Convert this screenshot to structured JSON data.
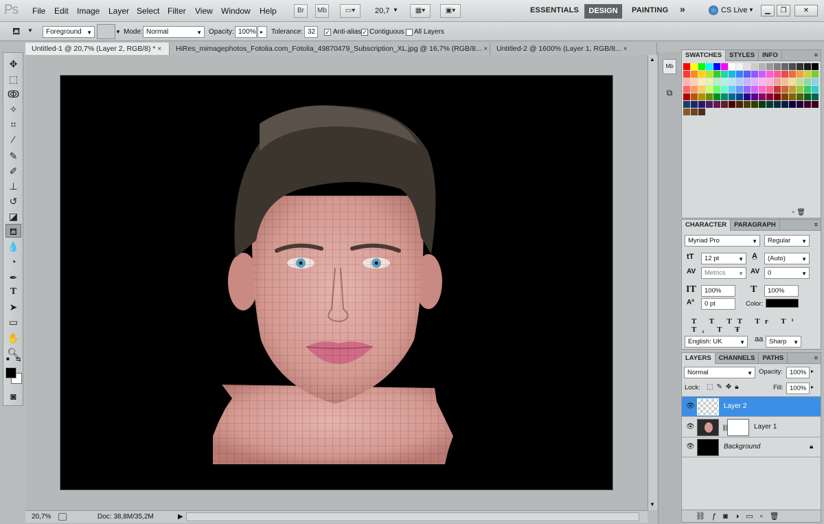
{
  "menubar": {
    "logo": "Ps",
    "menus": [
      "File",
      "Edit",
      "Image",
      "Layer",
      "Select",
      "Filter",
      "View",
      "Window",
      "Help"
    ],
    "bridge_label": "Br",
    "minibridge_label": "Mb",
    "zoom": "20,7",
    "workspaces": {
      "essentials": "ESSENTIALS",
      "design": "DESIGN",
      "painting": "PAINTING",
      "more": "»"
    },
    "cs_live": "CS Live"
  },
  "options": {
    "fill_source": "Foreground",
    "mode_label": "Mode:",
    "mode_value": "Normal",
    "opacity_label": "Opacity:",
    "opacity_value": "100%",
    "tolerance_label": "Tolerance:",
    "tolerance_value": "32",
    "antialias_label": "Anti-alias",
    "contiguous_label": "Contiguous",
    "all_layers_label": "All Layers"
  },
  "tabs": [
    {
      "label": "Untitled-1 @ 20,7% (Layer 2, RGB/8) *",
      "close": "×"
    },
    {
      "label": "HiRes_mimagephotos_Fotolia.com_Fotolia_49870479_Subscription_XL.jpg @ 16,7% (RGB/8...",
      "close": "×"
    },
    {
      "label": "Untitled-2 @ 1600% (Layer 1, RGB/8...",
      "close": "×"
    }
  ],
  "status": {
    "zoom": "20,7%",
    "doc": "Doc: 38,8M/35,2M"
  },
  "swatches": {
    "tabs": [
      "SWATCHES",
      "STYLES",
      "INFO"
    ],
    "rows": [
      [
        "#ff0000",
        "#ffff00",
        "#00ff00",
        "#00ffff",
        "#0000ff",
        "#ff00ff",
        "#ffffff",
        "#f2f2f2",
        "#e0e0e0",
        "#cccccc",
        "#b3b3b3",
        "#999999",
        "#808080",
        "#666666",
        "#4d4d4d",
        "#333333",
        "#1a1a1a",
        "#000000"
      ],
      [
        "#ff3b30",
        "#ff8c1a",
        "#ffd21a",
        "#b8e61a",
        "#33cc33",
        "#1ad9a3",
        "#1ab8e6",
        "#3385ff",
        "#5c5cff",
        "#8c5cff",
        "#cc5cff",
        "#ff5cd6",
        "#ff5c8c",
        "#e64d4d",
        "#f26b3a",
        "#f7a03a",
        "#c8d23a",
        "#7acc3a"
      ],
      [
        "#ffb3b3",
        "#ffd1b3",
        "#ffeeb3",
        "#e0f5b3",
        "#b3f0c2",
        "#b3f0e6",
        "#b3e6f5",
        "#b3ccff",
        "#c2b3ff",
        "#e0b3ff",
        "#ffb3f0",
        "#ffb3cc",
        "#f2a0a0",
        "#f5bf8c",
        "#f2e08c",
        "#bfe08c",
        "#8cd9a6",
        "#8cd1e6"
      ],
      [
        "#ff6666",
        "#ff9966",
        "#ffcc66",
        "#ccff66",
        "#66ff66",
        "#66ffcc",
        "#66ccff",
        "#6699ff",
        "#9966ff",
        "#cc66ff",
        "#ff66cc",
        "#ff6699",
        "#cc3333",
        "#cc6633",
        "#cc9933",
        "#99cc33",
        "#33cc66",
        "#33cccc"
      ],
      [
        "#b30000",
        "#b35900",
        "#b38f00",
        "#6b8f00",
        "#008f24",
        "#008f6b",
        "#006b8f",
        "#00478f",
        "#24008f",
        "#59008f",
        "#8f006b",
        "#8f0036",
        "#800000",
        "#804000",
        "#806600",
        "#4d6600",
        "#006619",
        "#00664d"
      ],
      [
        "#1a3d66",
        "#1a2966",
        "#2b1a66",
        "#4d1a66",
        "#661a52",
        "#661a2b",
        "#4d0000",
        "#4d2600",
        "#4d3d00",
        "#2e3d00",
        "#003d0f",
        "#003d2e",
        "#002e3d",
        "#001f3d",
        "#0f003d",
        "#26003d",
        "#3d002e",
        "#3d0017"
      ],
      [
        "#8b5a2b",
        "#6b4423",
        "#4a2f1a"
      ]
    ]
  },
  "character": {
    "tabs": [
      "CHARACTER",
      "PARAGRAPH"
    ],
    "font_family": "Myriad Pro",
    "font_style": "Regular",
    "size": "12 pt",
    "leading": "(Auto)",
    "kerning": "Metrics",
    "tracking": "0",
    "vscale": "100%",
    "hscale": "100%",
    "baseline": "0 pt",
    "color_label": "Color:",
    "color": "#000000",
    "language": "English: UK",
    "aa_label": "a",
    "aa_value": "Sharp"
  },
  "layers": {
    "tabs": [
      "LAYERS",
      "CHANNELS",
      "PATHS"
    ],
    "blend": "Normal",
    "opacity_label": "Opacity:",
    "opacity": "100%",
    "lock_label": "Lock:",
    "fill_label": "Fill:",
    "fill": "100%",
    "items": [
      {
        "name": "Layer 2",
        "selected": true
      },
      {
        "name": "Layer 1",
        "selected": false
      },
      {
        "name": "Background",
        "selected": false
      }
    ]
  }
}
